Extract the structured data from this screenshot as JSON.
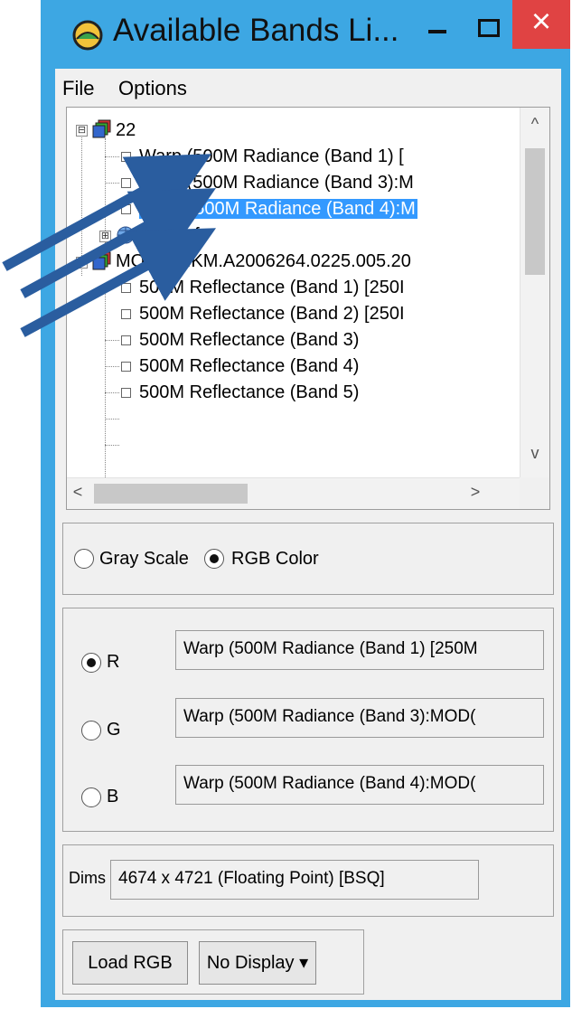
{
  "window": {
    "title": "Available Bands Li...",
    "minimize_symbol": "–",
    "close_symbol": "×"
  },
  "menu": {
    "items": [
      "File",
      "Options"
    ]
  },
  "tree": {
    "rows": [
      {
        "label": "22",
        "icon": "database-icon",
        "expander": "⊟"
      },
      {
        "label": "Warp (500M Radiance (Band 1) [",
        "icon": "band-leaf-icon"
      },
      {
        "label": "Warp (500M Radiance (Band 3):M",
        "icon": "band-leaf-icon"
      },
      {
        "label": "Warp (500M Radiance (Band 4):M",
        "icon": "band-leaf-icon",
        "selected": true
      },
      {
        "label": "Map Info",
        "icon": "globe-icon",
        "expander": "⊞"
      },
      {
        "label": "MOD02HKM.A2006264.0225.005.20",
        "icon": "database-icon",
        "expander": "⊟"
      },
      {
        "label": "500M Reflectance (Band 1) [250I",
        "icon": "band-leaf-icon"
      },
      {
        "label": "500M Reflectance (Band 2) [250I",
        "icon": "band-leaf-icon"
      },
      {
        "label": "500M Reflectance (Band 3)",
        "icon": "band-leaf-icon"
      },
      {
        "label": "500M Reflectance (Band 4)",
        "icon": "band-leaf-icon"
      },
      {
        "label": "500M Reflectance (Band 5)",
        "icon": "band-leaf-icon"
      }
    ],
    "scroll_up": "^",
    "scroll_down": "v",
    "scroll_left": "<",
    "scroll_right": ">"
  },
  "mode": {
    "gray_label": "Gray Scale",
    "rgb_label": "RGB Color",
    "selected": "rgb"
  },
  "channels": {
    "r": {
      "label": "R",
      "value": "Warp (500M Radiance (Band 1) [250M",
      "checked": true
    },
    "g": {
      "label": "G",
      "value": "Warp (500M Radiance (Band 3):MOD(",
      "checked": false
    },
    "b": {
      "label": "B",
      "value": "Warp (500M Radiance (Band 4):MOD(",
      "checked": false
    }
  },
  "dims": {
    "label": "Dims",
    "value": "4674 x 4721 (Floating Point) [BSQ]"
  },
  "buttons": {
    "load": "Load RGB",
    "display": "No Display ▾"
  },
  "colors": {
    "frame": "#3da7e3",
    "close": "#e04343",
    "selection": "#3399ff",
    "arrow": "#2a5d9f"
  }
}
